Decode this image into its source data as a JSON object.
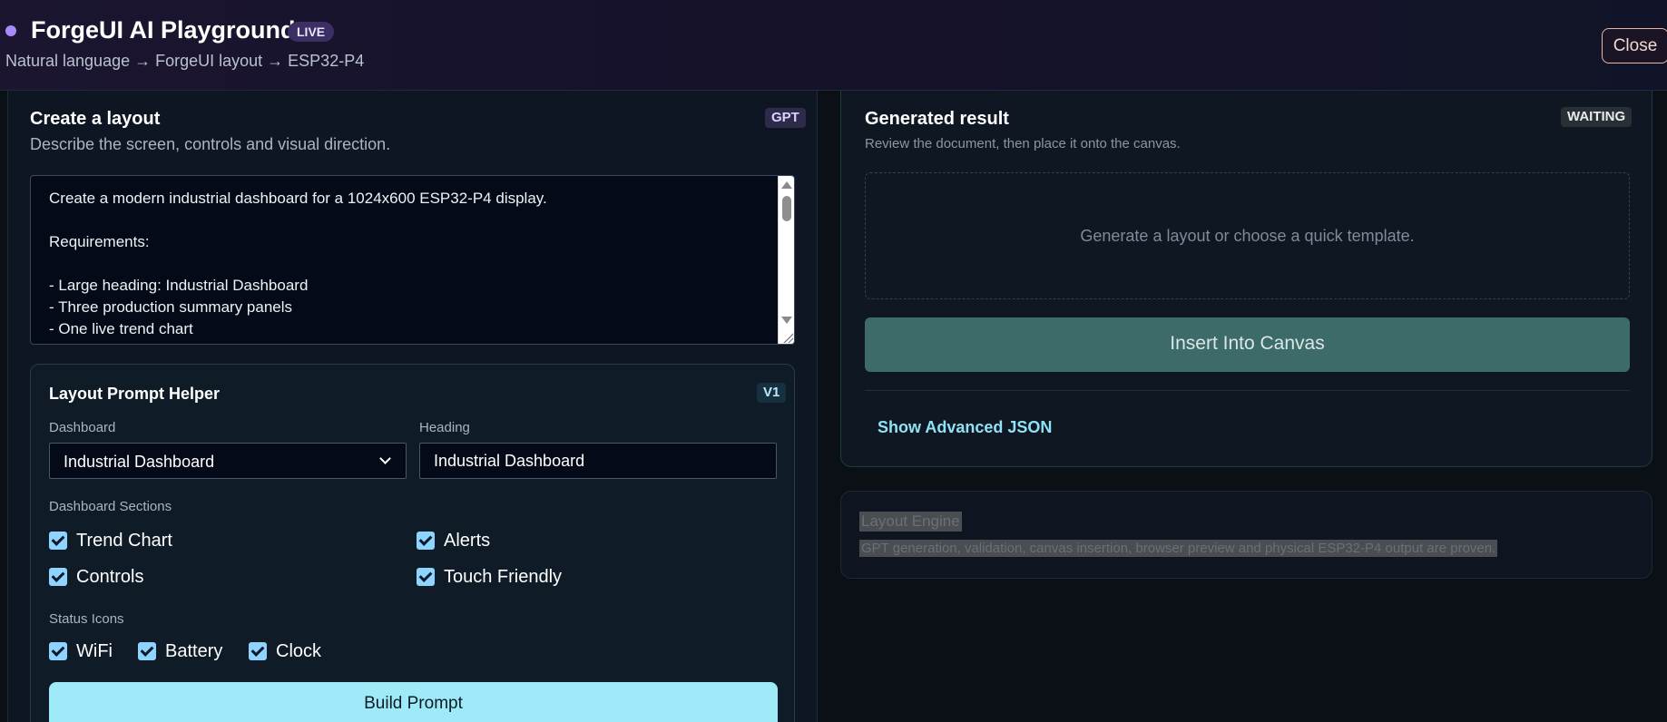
{
  "header": {
    "title": "ForgeUI AI Playground",
    "badge": "LIVE",
    "subtitle": "Natural language → ForgeUI layout → ESP32-P4",
    "close_label": "Close"
  },
  "create": {
    "title": "Create a layout",
    "tag": "GPT",
    "description": "Describe the screen, controls and visual direction.",
    "prompt_value": "Create a modern industrial dashboard for a 1024x600 ESP32-P4 display.\n\nRequirements:\n\n- Large heading: Industrial Dashboard\n- Three production summary panels\n- One live trend chart\n- Control panel"
  },
  "helper": {
    "title": "Layout Prompt Helper",
    "tag": "V1",
    "dashboard_label": "Dashboard",
    "dashboard_value": "Industrial Dashboard",
    "heading_label": "Heading",
    "heading_value": "Industrial Dashboard",
    "sections_label": "Dashboard Sections",
    "sections": [
      {
        "label": "Trend Chart",
        "checked": true
      },
      {
        "label": "Alerts",
        "checked": true
      },
      {
        "label": "Controls",
        "checked": true
      },
      {
        "label": "Touch Friendly",
        "checked": true
      }
    ],
    "status_label": "Status Icons",
    "status_icons": [
      {
        "label": "WiFi",
        "checked": true
      },
      {
        "label": "Battery",
        "checked": true
      },
      {
        "label": "Clock",
        "checked": true
      }
    ],
    "build_label": "Build Prompt"
  },
  "result": {
    "title": "Generated result",
    "tag": "WAITING",
    "description": "Review the document, then place it onto the canvas.",
    "empty_text": "Generate a layout or choose a quick template.",
    "insert_label": "Insert Into Canvas",
    "advanced_label": "Show Advanced JSON"
  },
  "engine": {
    "title": "Layout Engine",
    "description": "GPT generation, validation, canvas insertion, browser preview and physical ESP32-P4 output are proven."
  }
}
